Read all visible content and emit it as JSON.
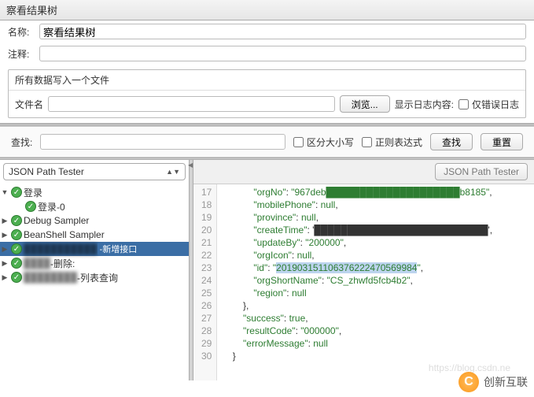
{
  "title": "察看结果树",
  "name_label": "名称:",
  "name_value": "察看结果树",
  "comment_label": "注释:",
  "comment_value": "",
  "file_section_title": "所有数据写入一个文件",
  "file_label": "文件名",
  "file_value": "",
  "browse_label": "浏览...",
  "show_log_label": "显示日志内容:",
  "only_error_label": "仅错误日志",
  "search_label": "查找:",
  "search_value": "",
  "case_label": "区分大小写",
  "regex_label": "正则表达式",
  "search_btn": "查找",
  "reset_btn": "重置",
  "renderer": "JSON Path Tester",
  "json_path_btn": "JSON Path Tester",
  "tree": [
    {
      "expander": "▼",
      "indent": 0,
      "label": "登录",
      "selected": false
    },
    {
      "expander": "",
      "indent": 1,
      "label": "登录-0",
      "selected": false
    },
    {
      "expander": "▶",
      "indent": 0,
      "label": "Debug Sampler",
      "selected": false
    },
    {
      "expander": "▶",
      "indent": 0,
      "label": "BeanShell Sampler",
      "selected": false
    },
    {
      "expander": "▶",
      "indent": 0,
      "label": "███████████",
      "suffix": "-新增接口",
      "selected": true,
      "blur": true
    },
    {
      "expander": "▶",
      "indent": 0,
      "label": "████",
      "suffix": "-删除:",
      "selected": false,
      "blur": true
    },
    {
      "expander": "▶",
      "indent": 0,
      "label": "████████",
      "suffix": "-列表查询",
      "selected": false,
      "blur": true
    }
  ],
  "code_start": 17,
  "code_lines": [
    "            \"orgNo\": \"967deb████████████████████b8185\",",
    "            \"mobilePhone\": null,",
    "            \"province\": null,",
    "            \"createTime\": '██████████████████████████',",
    "            \"updateBy\": \"200000\",",
    "            \"orgIcon\": null,",
    "            \"id\": \"201903151106376222470569984\",",
    "            \"orgShortName\": \"CS_zhwfd5fcb4b2\",",
    "            \"region\": null",
    "        },",
    "        \"success\": true,",
    "        \"resultCode\": \"000000\",",
    "        \"errorMessage\": null",
    "    }"
  ],
  "highlight_line_index": 6,
  "highlight_text": "201903151106376222470569984",
  "watermark": "创新互联",
  "csdn_url": "https://blog.csdn.ne",
  "chart_data": null
}
